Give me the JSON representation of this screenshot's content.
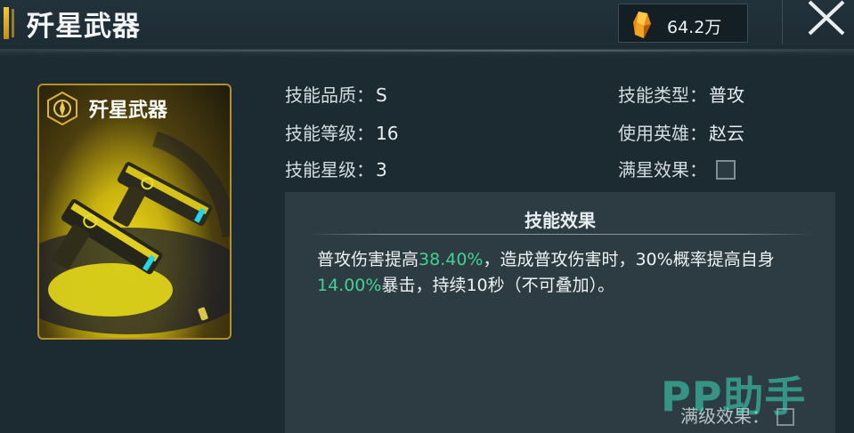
{
  "header": {
    "title": "歼星武器",
    "currency_amount": "64.2万"
  },
  "card": {
    "title": "歼星武器"
  },
  "skill": {
    "quality_label": "技能品质：",
    "quality_value": "S",
    "level_label": "技能等级：",
    "level_value": "16",
    "star_label": "技能星级：",
    "star_value": "3",
    "type_label": "技能类型：",
    "type_value": "普攻",
    "hero_label": "使用英雄：",
    "hero_value": "赵云",
    "fullstar_label": "满星效果："
  },
  "effect": {
    "title": "技能效果",
    "seg1": "普攻伤害提高",
    "val1": "38.40%",
    "seg2": "，造成普攻伤害时，30%概率提高自身",
    "val2": "14.00%",
    "seg3": "暴击，持续10秒（不可叠加）。",
    "max_level_label": "满级效果："
  },
  "watermark": "PP助手",
  "colors": {
    "highlight": "#43d190",
    "card_gold": "#f4e21c",
    "background": "#1c2a31"
  },
  "icons": [
    "crystal-icon",
    "close-icon",
    "skill-badge-icon",
    "weapon-art"
  ]
}
